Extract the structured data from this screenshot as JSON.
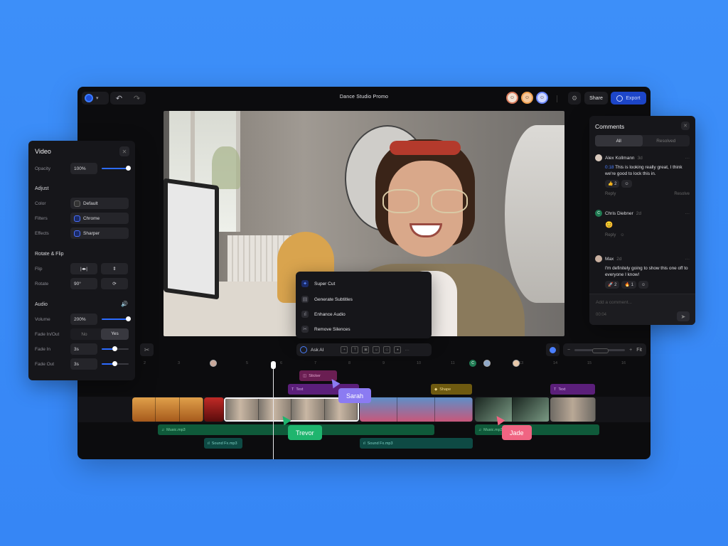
{
  "app": {
    "title": "Dance Studio Promo",
    "share_label": "Share",
    "export_label": "Export"
  },
  "video_panel": {
    "title": "Video",
    "opacity": {
      "label": "Opacity",
      "value": "100%",
      "level": 1.0
    },
    "adjust_title": "Adjust",
    "color": {
      "label": "Color",
      "value": "Default"
    },
    "filters": {
      "label": "Filters",
      "value": "Chrome"
    },
    "effects": {
      "label": "Effects",
      "value": "Sharper"
    },
    "rotate_flip_title": "Rotate & Flip",
    "flip_label": "Flip",
    "rotate": {
      "label": "Rotate",
      "value": "90°"
    },
    "audio_title": "Audio",
    "volume": {
      "label": "Volume",
      "value": "200%",
      "level": 1.0
    },
    "fade": {
      "label": "Fade In/Out",
      "no": "No",
      "yes": "Yes",
      "selected": "Yes"
    },
    "fade_in": {
      "label": "Fade In",
      "value": "3s",
      "level": 0.3
    },
    "fade_out": {
      "label": "Fade Out",
      "value": "3s",
      "level": 0.3
    }
  },
  "comments": {
    "title": "Comments",
    "tabs": [
      "All",
      "Resolved"
    ],
    "items": [
      {
        "author": "Alex Kollmann",
        "time": "3d",
        "mention": "0:18",
        "text": "This is looking really great, I think we're good to lock this in.",
        "reactions": [
          "👍 2",
          "☺"
        ],
        "reply": "Reply",
        "resolve": "Resolve"
      },
      {
        "author": "Chris Diebner",
        "time": "2d",
        "initial": "C",
        "text": "😊",
        "reply": "Reply"
      },
      {
        "author": "Max",
        "time": "2d",
        "text": "I'm definitely going to show this one off to everyone I know!",
        "reactions": [
          "🚀 2",
          "🔥 1",
          "☺"
        ]
      }
    ],
    "input_placeholder": "Add a comment...",
    "input_time": "00:04"
  },
  "ai_menu": {
    "items": [
      "Super Cut",
      "Generate Subtitles",
      "Enhance Audio",
      "Remove Silences"
    ]
  },
  "toolbar": {
    "ask_ai": "Ask AI",
    "zoom_fit": "Fit"
  },
  "timeline": {
    "ticks": [
      "2",
      "3",
      "4",
      "5",
      "6",
      "7",
      "8",
      "9",
      "10",
      "11",
      "12",
      "13",
      "14",
      "15",
      "16"
    ],
    "clips": {
      "sticker": "Sticker",
      "text1": "Text",
      "shape": "Shape",
      "text2": "Text",
      "music1": "Music.mp3",
      "music2": "Music.mp3",
      "sfx1": "Sound Fx.mp3",
      "sfx2": "Sound Fx.mp3"
    },
    "marker_initial": "C"
  },
  "collaborators": {
    "sarah": {
      "name": "Sarah",
      "color": "#8b7bf2"
    },
    "trevor": {
      "name": "Trevor",
      "color": "#1fb56e"
    },
    "jade": {
      "name": "Jade",
      "color": "#f06482"
    }
  },
  "colors": {
    "background": "#3a8cf8",
    "accent": "#2c6bff"
  }
}
